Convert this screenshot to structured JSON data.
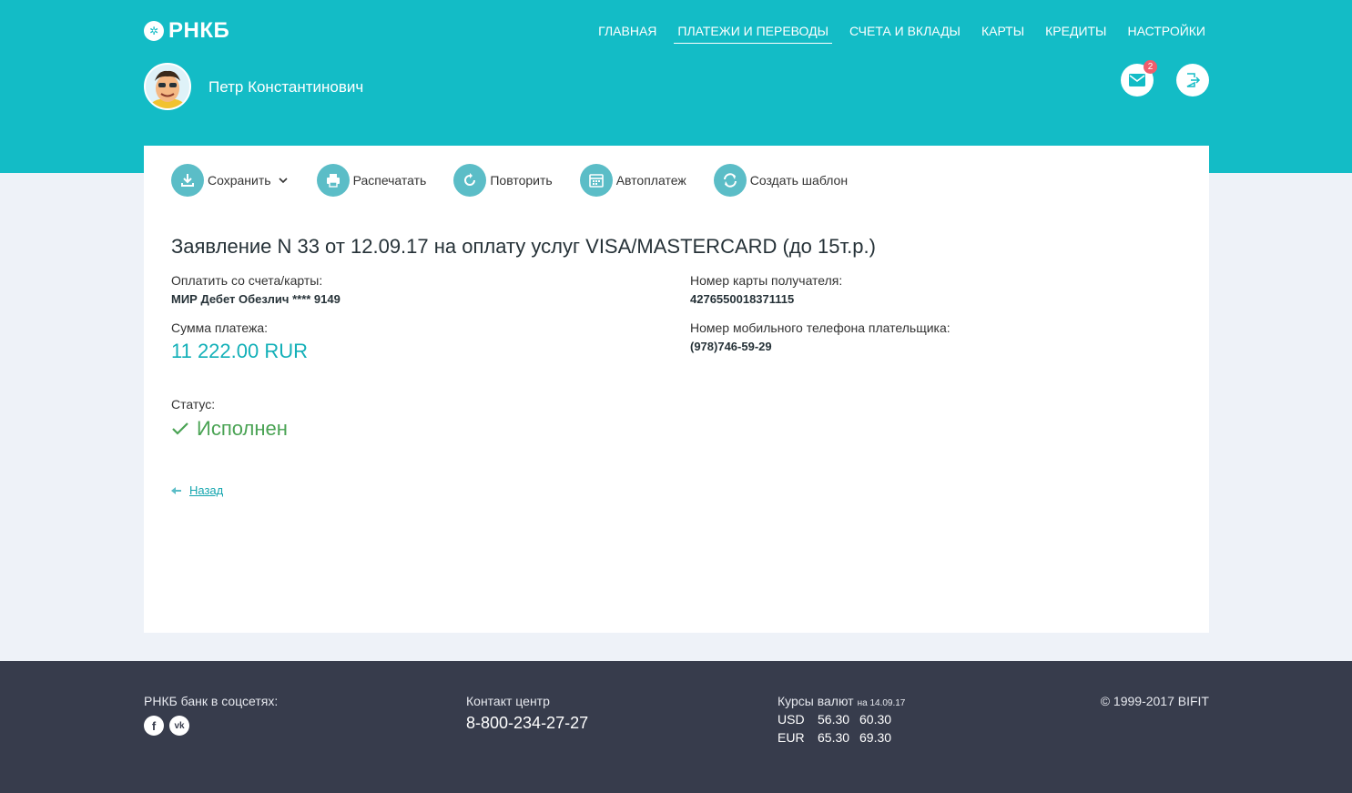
{
  "header": {
    "logo_mark": "✲",
    "logo_text": "РНКБ",
    "nav": [
      "ГЛАВНАЯ",
      "ПЛАТЕЖИ И ПЕРЕВОДЫ",
      "СЧЕТА И ВКЛАДЫ",
      "КАРТЫ",
      "КРЕДИТЫ",
      "НАСТРОЙКИ"
    ],
    "nav_active_index": 1,
    "user_name": "Петр Константинович",
    "mail_badge": "2"
  },
  "toolbar": {
    "save": "Сохранить",
    "print": "Распечатать",
    "repeat": "Повторить",
    "autopay": "Автоплатеж",
    "template": "Создать шаблон"
  },
  "document": {
    "title": "Заявление N 33 от 12.09.17 на оплату услуг VISA/MASTERCARD (до 15т.р.)",
    "from_label": "Оплатить со счета/карты:",
    "from_value": "МИР Дебет Обезлич **** 9149",
    "amount_label": "Сумма платежа:",
    "amount_value": "11 222.00 RUR",
    "card_label": "Номер карты получателя:",
    "card_value": "4276550018371115",
    "phone_label": "Номер мобильного телефона плательщика:",
    "phone_value": "(978)746-59-29",
    "status_label": "Статус:",
    "status_value": "Исполнен",
    "back_label": "Назад"
  },
  "footer": {
    "social_label": "РНКБ банк в соцсетях:",
    "social_fb": "f",
    "social_vk": "vk",
    "contact_label": "Контакт центр",
    "contact_phone": "8-800-234-27-27",
    "rates_label": "Курсы валют",
    "rates_date": "на 14.09.17",
    "rates": [
      {
        "code": "USD",
        "buy": "56.30",
        "sell": "60.30"
      },
      {
        "code": "EUR",
        "buy": "65.30",
        "sell": "69.30"
      }
    ],
    "copyright": "© 1999-2017 BIFIT"
  },
  "colors": {
    "brand": "#13bcc6",
    "status_ok": "#4aa354",
    "footer_bg": "#373c4c",
    "badge": "#f05d6c"
  }
}
